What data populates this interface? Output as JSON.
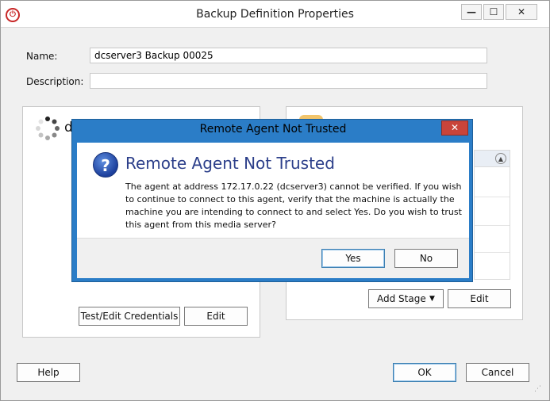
{
  "window": {
    "title": "Backup Definition Properties",
    "min_glyph": "—",
    "max_glyph": "☐",
    "close_glyph": "✕",
    "app_icon_glyph": "⏻"
  },
  "form": {
    "name_label": "Name:",
    "name_value": "dcserver3 Backup 00025",
    "description_label": "Description:",
    "description_value": ""
  },
  "left_panel": {
    "partial_text": "d",
    "test_edit_button": "Test/Edit Credentials",
    "edit_button": "Edit"
  },
  "right_panel": {
    "add_stage_button": "Add Stage",
    "edit_button": "Edit"
  },
  "footer": {
    "help_button": "Help",
    "ok_button": "OK",
    "cancel_button": "Cancel"
  },
  "dialog": {
    "title": "Remote Agent Not Trusted",
    "close_glyph": "✕",
    "heading": "Remote Agent Not Trusted",
    "message_lines": [
      "The agent at address 172.17.0.22 (dcserver3) cannot be verified.   If you wish",
      "to continue to connect to this agent, verify that the machine is actually the",
      "machine you are intending to connect to and select Yes.  Do you wish to trust",
      "this agent from this media server?"
    ],
    "yes_button": "Yes",
    "no_button": "No",
    "icon_glyph": "?"
  }
}
